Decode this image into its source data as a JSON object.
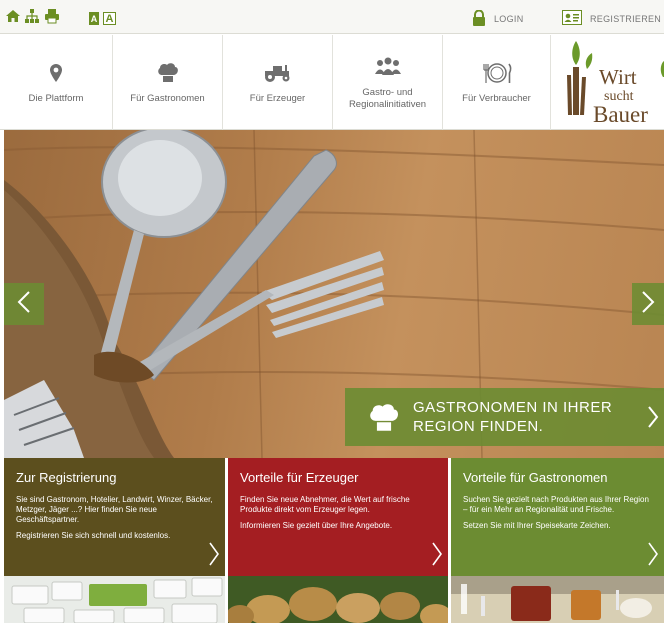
{
  "topbar": {
    "font_small": "A",
    "font_large": "A",
    "login": "LOGIN",
    "register": "REGISTRIEREN",
    "icons": [
      "home-icon",
      "sitemap-icon",
      "print-icon"
    ]
  },
  "nav": {
    "items": [
      {
        "label": "Die Plattform",
        "icon": "location-pin-icon"
      },
      {
        "label": "Für Gastronomen",
        "icon": "chef-hat-icon"
      },
      {
        "label": "Für Erzeuger",
        "icon": "tractor-icon"
      },
      {
        "label": "Gastro- und Regionalinitiativen",
        "icon": "group-icon"
      },
      {
        "label": "Für Verbraucher",
        "icon": "plate-cutlery-icon"
      }
    ]
  },
  "logo": {
    "line1": "Wirt",
    "line2": "sucht",
    "line3": "Bauer"
  },
  "hero": {
    "cta_line1": "GASTRONOMEN IN IHRER",
    "cta_line2": "REGION FINDEN."
  },
  "panels": [
    {
      "title": "Zur Registrierung",
      "p1": "Sie sind Gastronom, Hotelier, Landwirt, Winzer, Bäcker, Metzger, Jäger ...? Hier finden Sie neue Geschäftspartner.",
      "p2": "Registrieren Sie sich schnell und kostenlos."
    },
    {
      "title": "Vorteile für Erzeuger",
      "p1": "Finden Sie neue Abnehmer, die Wert auf frische Produkte direkt vom Erzeuger legen.",
      "p2": "Informieren Sie gezielt über Ihre Angebote."
    },
    {
      "title": "Vorteile für Gastronomen",
      "p1": "Suchen Sie gezielt nach Produkten aus Ihrer Region – für ein Mehr an Regionalität und Frische.",
      "p2": "Setzen Sie mit Ihrer Speisekarte Zeichen."
    }
  ],
  "colors": {
    "accent_green": "#6c8c32",
    "panel_brown": "#5c4f1e",
    "panel_red": "#a41e22",
    "panel_olive": "#6c8c32",
    "logo_brown": "#6a4a2a"
  }
}
